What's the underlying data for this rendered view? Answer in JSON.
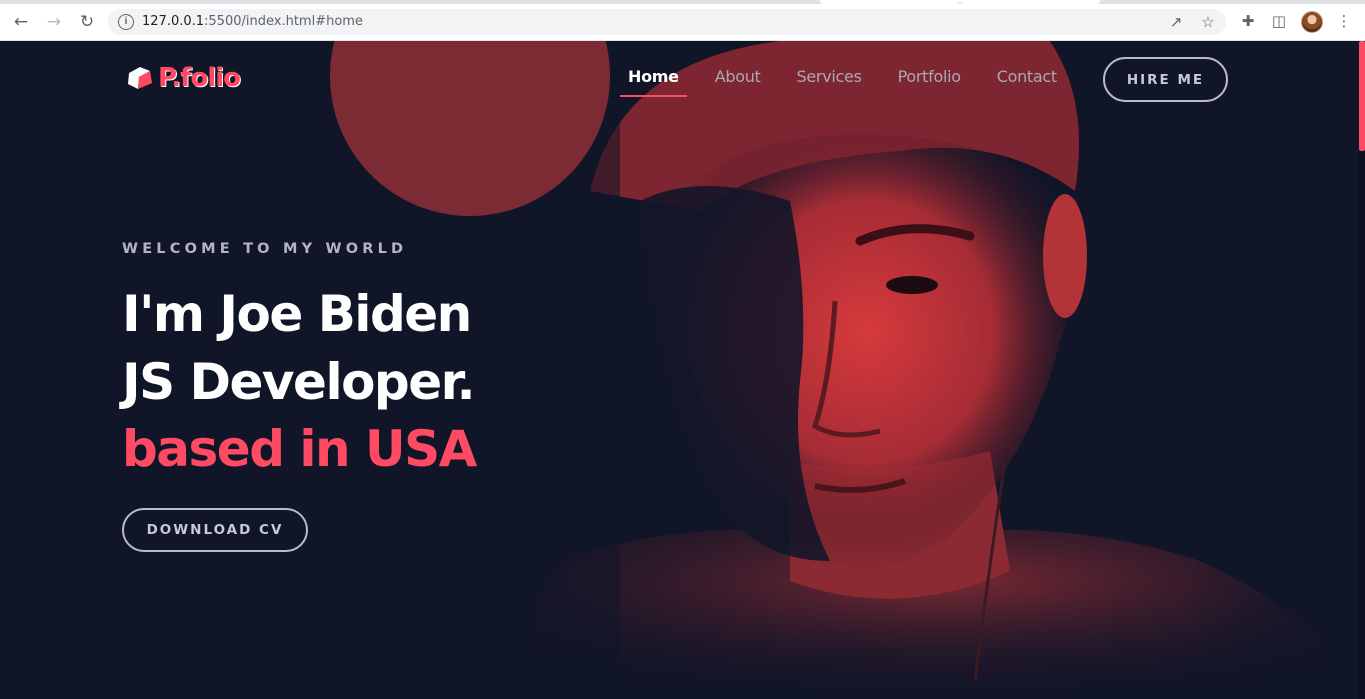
{
  "browser": {
    "url_host": "127.0.0.1",
    "url_path": ":5500/index.html#home",
    "icons": {
      "back": "arrow-left-icon",
      "forward": "arrow-right-icon",
      "reload": "reload-icon",
      "info": "info-icon",
      "share": "share-icon",
      "bookmark": "star-icon",
      "extensions": "puzzle-icon",
      "side_panel": "side-panel-icon",
      "menu": "kebab-menu-icon"
    }
  },
  "site": {
    "logo_text": "P.folio",
    "nav": [
      {
        "label": "Home",
        "active": true
      },
      {
        "label": "About",
        "active": false
      },
      {
        "label": "Services",
        "active": false
      },
      {
        "label": "Portfolio",
        "active": false
      },
      {
        "label": "Contact",
        "active": false
      }
    ],
    "hire_label": "HIRE ME"
  },
  "hero": {
    "welcome": "WELCOME TO MY WORLD",
    "line1": "I'm Joe Biden",
    "line2": "JS Developer.",
    "line3": "based in USA",
    "cv_label": "DOWNLOAD CV"
  },
  "colors": {
    "accent": "#ff4a64",
    "background": "#111528",
    "portrait_tint": "#e23e3e"
  }
}
